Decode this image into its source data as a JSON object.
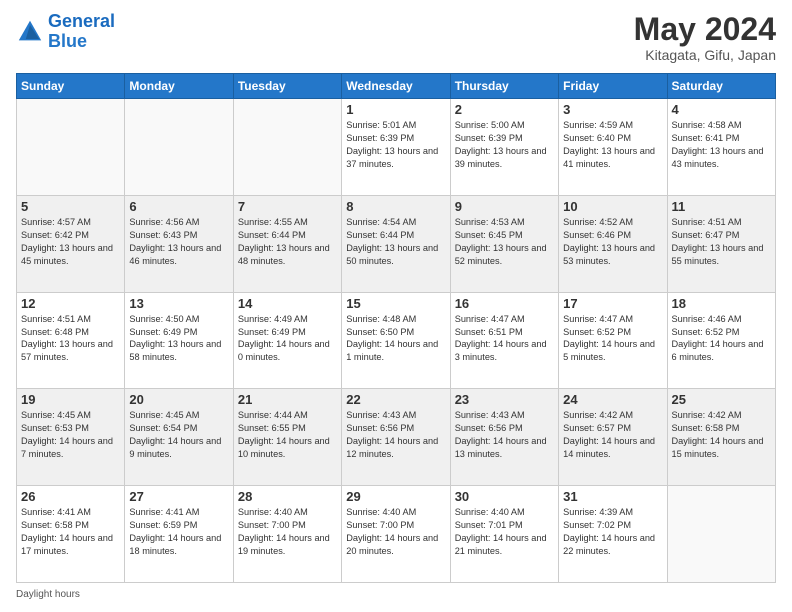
{
  "header": {
    "logo_general": "General",
    "logo_blue": "Blue",
    "title": "May 2024",
    "location": "Kitagata, Gifu, Japan"
  },
  "days_of_week": [
    "Sunday",
    "Monday",
    "Tuesday",
    "Wednesday",
    "Thursday",
    "Friday",
    "Saturday"
  ],
  "footer": {
    "label": "Daylight hours"
  },
  "weeks": [
    {
      "shaded": false,
      "days": [
        {
          "number": "",
          "info": ""
        },
        {
          "number": "",
          "info": ""
        },
        {
          "number": "",
          "info": ""
        },
        {
          "number": "1",
          "info": "Sunrise: 5:01 AM\nSunset: 6:39 PM\nDaylight: 13 hours and 37 minutes."
        },
        {
          "number": "2",
          "info": "Sunrise: 5:00 AM\nSunset: 6:39 PM\nDaylight: 13 hours and 39 minutes."
        },
        {
          "number": "3",
          "info": "Sunrise: 4:59 AM\nSunset: 6:40 PM\nDaylight: 13 hours and 41 minutes."
        },
        {
          "number": "4",
          "info": "Sunrise: 4:58 AM\nSunset: 6:41 PM\nDaylight: 13 hours and 43 minutes."
        }
      ]
    },
    {
      "shaded": true,
      "days": [
        {
          "number": "5",
          "info": "Sunrise: 4:57 AM\nSunset: 6:42 PM\nDaylight: 13 hours and 45 minutes."
        },
        {
          "number": "6",
          "info": "Sunrise: 4:56 AM\nSunset: 6:43 PM\nDaylight: 13 hours and 46 minutes."
        },
        {
          "number": "7",
          "info": "Sunrise: 4:55 AM\nSunset: 6:44 PM\nDaylight: 13 hours and 48 minutes."
        },
        {
          "number": "8",
          "info": "Sunrise: 4:54 AM\nSunset: 6:44 PM\nDaylight: 13 hours and 50 minutes."
        },
        {
          "number": "9",
          "info": "Sunrise: 4:53 AM\nSunset: 6:45 PM\nDaylight: 13 hours and 52 minutes."
        },
        {
          "number": "10",
          "info": "Sunrise: 4:52 AM\nSunset: 6:46 PM\nDaylight: 13 hours and 53 minutes."
        },
        {
          "number": "11",
          "info": "Sunrise: 4:51 AM\nSunset: 6:47 PM\nDaylight: 13 hours and 55 minutes."
        }
      ]
    },
    {
      "shaded": false,
      "days": [
        {
          "number": "12",
          "info": "Sunrise: 4:51 AM\nSunset: 6:48 PM\nDaylight: 13 hours and 57 minutes."
        },
        {
          "number": "13",
          "info": "Sunrise: 4:50 AM\nSunset: 6:49 PM\nDaylight: 13 hours and 58 minutes."
        },
        {
          "number": "14",
          "info": "Sunrise: 4:49 AM\nSunset: 6:49 PM\nDaylight: 14 hours and 0 minutes."
        },
        {
          "number": "15",
          "info": "Sunrise: 4:48 AM\nSunset: 6:50 PM\nDaylight: 14 hours and 1 minute."
        },
        {
          "number": "16",
          "info": "Sunrise: 4:47 AM\nSunset: 6:51 PM\nDaylight: 14 hours and 3 minutes."
        },
        {
          "number": "17",
          "info": "Sunrise: 4:47 AM\nSunset: 6:52 PM\nDaylight: 14 hours and 5 minutes."
        },
        {
          "number": "18",
          "info": "Sunrise: 4:46 AM\nSunset: 6:52 PM\nDaylight: 14 hours and 6 minutes."
        }
      ]
    },
    {
      "shaded": true,
      "days": [
        {
          "number": "19",
          "info": "Sunrise: 4:45 AM\nSunset: 6:53 PM\nDaylight: 14 hours and 7 minutes."
        },
        {
          "number": "20",
          "info": "Sunrise: 4:45 AM\nSunset: 6:54 PM\nDaylight: 14 hours and 9 minutes."
        },
        {
          "number": "21",
          "info": "Sunrise: 4:44 AM\nSunset: 6:55 PM\nDaylight: 14 hours and 10 minutes."
        },
        {
          "number": "22",
          "info": "Sunrise: 4:43 AM\nSunset: 6:56 PM\nDaylight: 14 hours and 12 minutes."
        },
        {
          "number": "23",
          "info": "Sunrise: 4:43 AM\nSunset: 6:56 PM\nDaylight: 14 hours and 13 minutes."
        },
        {
          "number": "24",
          "info": "Sunrise: 4:42 AM\nSunset: 6:57 PM\nDaylight: 14 hours and 14 minutes."
        },
        {
          "number": "25",
          "info": "Sunrise: 4:42 AM\nSunset: 6:58 PM\nDaylight: 14 hours and 15 minutes."
        }
      ]
    },
    {
      "shaded": false,
      "days": [
        {
          "number": "26",
          "info": "Sunrise: 4:41 AM\nSunset: 6:58 PM\nDaylight: 14 hours and 17 minutes."
        },
        {
          "number": "27",
          "info": "Sunrise: 4:41 AM\nSunset: 6:59 PM\nDaylight: 14 hours and 18 minutes."
        },
        {
          "number": "28",
          "info": "Sunrise: 4:40 AM\nSunset: 7:00 PM\nDaylight: 14 hours and 19 minutes."
        },
        {
          "number": "29",
          "info": "Sunrise: 4:40 AM\nSunset: 7:00 PM\nDaylight: 14 hours and 20 minutes."
        },
        {
          "number": "30",
          "info": "Sunrise: 4:40 AM\nSunset: 7:01 PM\nDaylight: 14 hours and 21 minutes."
        },
        {
          "number": "31",
          "info": "Sunrise: 4:39 AM\nSunset: 7:02 PM\nDaylight: 14 hours and 22 minutes."
        },
        {
          "number": "",
          "info": ""
        }
      ]
    }
  ]
}
